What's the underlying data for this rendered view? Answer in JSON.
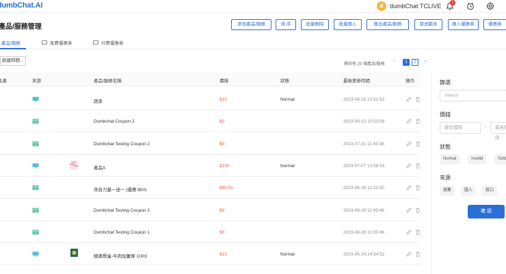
{
  "header": {
    "logo": "dumbChat.AI",
    "user_initial": "d",
    "user_name": "dumbChat TCLIVE",
    "notification_count": "1"
  },
  "page": {
    "title": "產品/服務管理"
  },
  "toolbar": [
    {
      "label": "添加產品/服務"
    },
    {
      "label": "排 序"
    },
    {
      "label": "批量刪除"
    },
    {
      "label": "批量匯入"
    },
    {
      "label": "匯出產品/服務"
    },
    {
      "label": "發送範本"
    },
    {
      "label": "匯入優惠券"
    },
    {
      "label": "優惠券"
    }
  ],
  "tabs": [
    {
      "label": "產品/服務",
      "active": true
    },
    {
      "label": "免費優惠券",
      "active": false
    },
    {
      "label": "付費優惠券",
      "active": false
    }
  ],
  "list": {
    "sort_label": "創建時間",
    "total_text": "總共有 25 個產品/服務",
    "pages": [
      "1",
      "2"
    ],
    "current_page": "1"
  },
  "table": {
    "headers": [
      "生產",
      "來源",
      "產品/服務名稱",
      "價錢",
      "狀態",
      "最後更新時間",
      "操作"
    ],
    "rows": [
      {
        "source": "web",
        "name": "蔬菜",
        "price": "$10",
        "status": "Normal",
        "time": "2023-09-18 13:51:52",
        "thumb": ""
      },
      {
        "source": "coupon",
        "name": "Dumbchat Coupon 2",
        "price": "$0",
        "status": "",
        "time": "2023-09-12 10:03:58",
        "thumb": ""
      },
      {
        "source": "coupon",
        "name": "Dumbchat Testing Coupon 2",
        "price": "$0",
        "status": "",
        "time": "2023-07-31 11:43:36",
        "thumb": ""
      },
      {
        "source": "web",
        "name": "產品A",
        "price": "$150",
        "status": "Normal",
        "time": "2023-07-07 13:58:53",
        "thumb": "cake"
      },
      {
        "source": "coupon",
        "name": "來自力量一送一 (優惠:$50)",
        "price": "$50.01",
        "status": "",
        "time": "2023-06-26 11:23:30",
        "thumb": ""
      },
      {
        "source": "coupon",
        "name": "Dumbchat Testing Coupon 2",
        "price": "$0",
        "status": "",
        "time": "2023-06-26 11:05:46",
        "thumb": ""
      },
      {
        "source": "coupon",
        "name": "Dumbchat Testing Coupon 1",
        "price": "$0",
        "status": "",
        "time": "2023-06-26 11:05:46",
        "thumb": ""
      },
      {
        "source": "web",
        "name": "經典餐盒-牛肉加薯條 100G",
        "price": "$10",
        "status": "Normal",
        "time": "2023-05-24 14:54:52",
        "thumb": "food"
      }
    ]
  },
  "filter": {
    "title": "篩選",
    "search_placeholder": "Search",
    "price_label": "價錢",
    "price_min_placeholder": "最低價錢",
    "price_sep": "-",
    "price_max_placeholder": "最高價錢",
    "status_label": "狀態",
    "status_options": [
      "Normal",
      "Invalid",
      "Sold"
    ],
    "source_label": "來源",
    "source_options": [
      "搜集",
      "匯入",
      "接口"
    ],
    "confirm_label": "確 認"
  },
  "colors": {
    "accent": "#2b6fd6",
    "price": "#e05a3a",
    "source_icon": "#3bb3c9"
  }
}
